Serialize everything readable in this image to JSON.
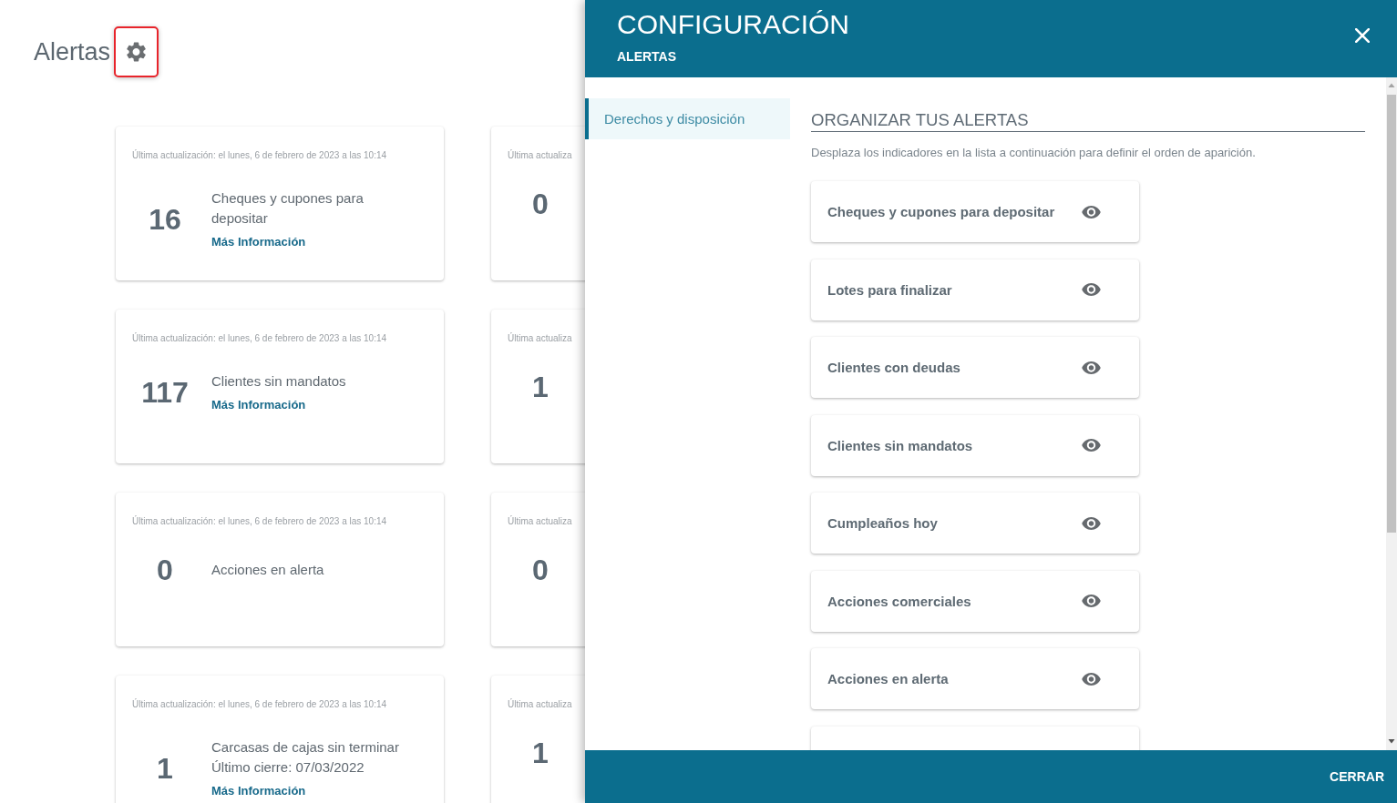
{
  "page": {
    "title": "Alertas",
    "settings_button": {
      "highlighted": true
    }
  },
  "cards": [
    {
      "updated": "Última actualización: el lunes, 6 de febrero de 2023 a las 10:14",
      "count": "16",
      "title": "Cheques y cupones para depositar",
      "link": "Más Información"
    },
    {
      "updated": "Última actualiza",
      "count": "0"
    },
    {
      "updated": "Última actualización: el lunes, 6 de febrero de 2023 a las 10:14",
      "count": "117",
      "title": "Clientes sin mandatos",
      "link": "Más Información"
    },
    {
      "updated": "Última actualiza",
      "count": "1"
    },
    {
      "updated": "Última actualización: el lunes, 6 de febrero de 2023 a las 10:14",
      "count": "0",
      "title": "Acciones en alerta"
    },
    {
      "updated": "Última actualiza",
      "count": "0"
    },
    {
      "updated": "Última actualización: el lunes, 6 de febrero de 2023 a las 10:14",
      "count": "1",
      "title": "Carcasas de cajas sin terminar",
      "subtitle": "Último cierre: 07/03/2022",
      "link": "Más Información"
    },
    {
      "updated": "Última actualiza",
      "count": "1"
    }
  ],
  "panel": {
    "title": "CONFIGURACIÓN",
    "subtitle": "ALERTAS",
    "sidebar": {
      "items": [
        {
          "label": "Derechos y disposición",
          "selected": true
        }
      ]
    },
    "section": {
      "heading": "ORGANIZAR TUS ALERTAS",
      "description": "Desplaza los indicadores en la lista a continuación para definir el orden de aparición.",
      "items": [
        {
          "label": "Cheques y cupones para depositar",
          "visible": true
        },
        {
          "label": "Lotes para finalizar",
          "visible": true
        },
        {
          "label": "Clientes con deudas",
          "visible": true
        },
        {
          "label": "Clientes sin mandatos",
          "visible": true
        },
        {
          "label": "Cumpleaños hoy",
          "visible": true
        },
        {
          "label": "Acciones comerciales",
          "visible": true
        },
        {
          "label": "Acciones en alerta",
          "visible": true
        }
      ],
      "more_below": true
    },
    "footer": {
      "button": "CERRAR"
    }
  }
}
